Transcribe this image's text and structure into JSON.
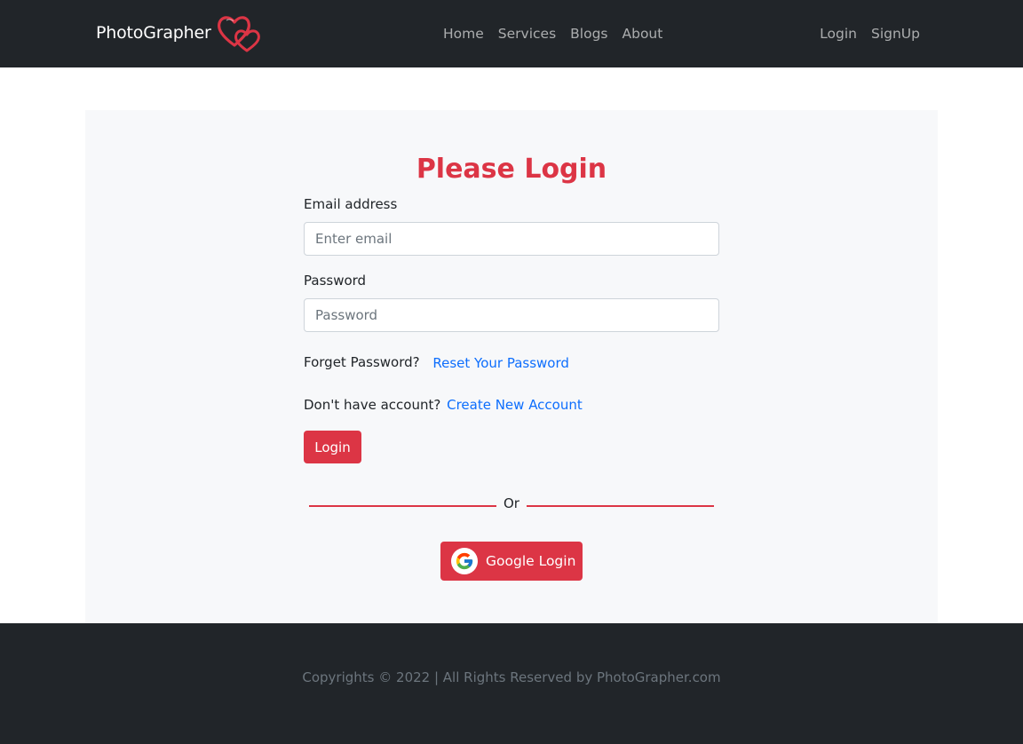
{
  "nav": {
    "brand": "PhotoGrapher",
    "center_links": [
      "Home",
      "Services",
      "Blogs",
      "About"
    ],
    "right_links": [
      "Login",
      "SignUp"
    ]
  },
  "login": {
    "title": "Please Login",
    "email_label": "Email address",
    "email_placeholder": "Enter email",
    "password_label": "Password",
    "password_placeholder": "Password",
    "forget_text": "Forget Password?",
    "reset_link": "Reset Your Password",
    "no_account_text": "Don't have account?",
    "create_link": "Create New Account",
    "login_button": "Login",
    "or_text": "Or",
    "google_button": "Google Login"
  },
  "footer": {
    "text": "Copyrights © 2022 | All Rights Reserved by PhotoGrapher.com"
  },
  "colors": {
    "accent": "#dc3545",
    "navbar_bg": "#212529",
    "link": "#0d6efd",
    "panel_bg": "#f7f8fa"
  },
  "icons": {
    "brand_logo": "double-heart-icon",
    "google": "google-g-icon"
  }
}
